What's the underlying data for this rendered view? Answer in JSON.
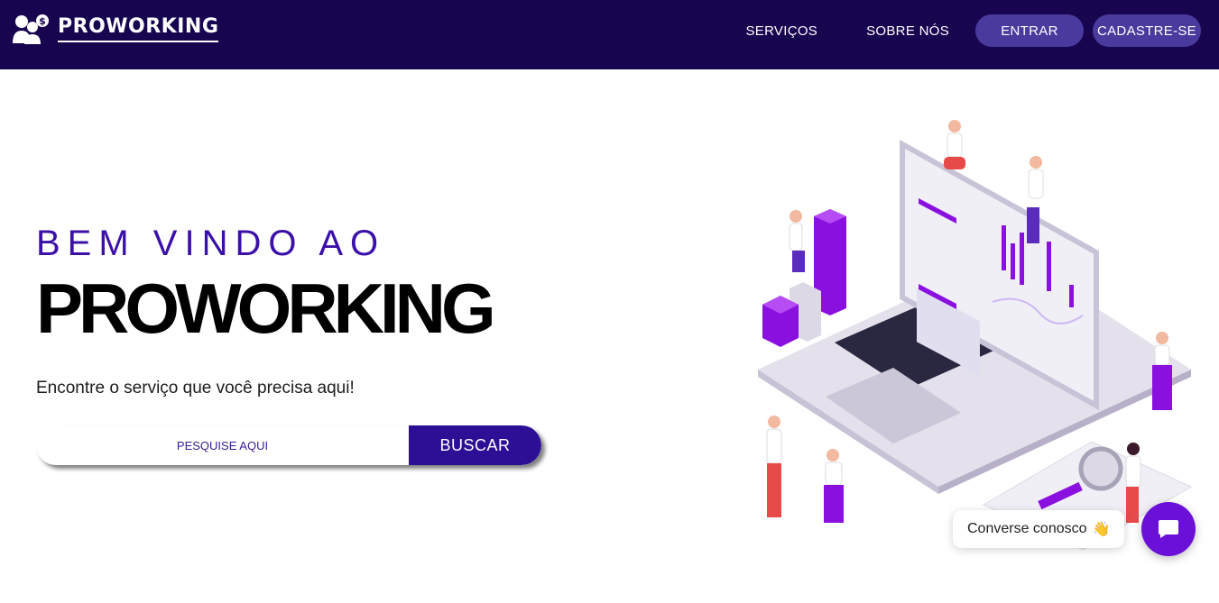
{
  "header": {
    "logo_text": "PROWORKING",
    "nav": {
      "services": "SERVIÇOS",
      "about": "SOBRE NÓS",
      "login": "ENTRAR",
      "signup": "CADASTRE-SE"
    }
  },
  "hero": {
    "welcome": "BEM VINDO AO",
    "brand": "PROWORKING",
    "tagline": "Encontre o serviço que você precisa aqui!",
    "search": {
      "placeholder": "PESQUISE AQUI",
      "button": "BUSCAR"
    }
  },
  "chat": {
    "label": "Converse conosco",
    "emoji": "👋"
  },
  "colors": {
    "header_bg": "#180550",
    "pill_bg": "#4a3a9e",
    "accent": "#2d0f95",
    "purple": "#8a10e0"
  },
  "icons": [
    "users-dollar-icon",
    "chat-icon",
    "waving-hand-icon"
  ]
}
